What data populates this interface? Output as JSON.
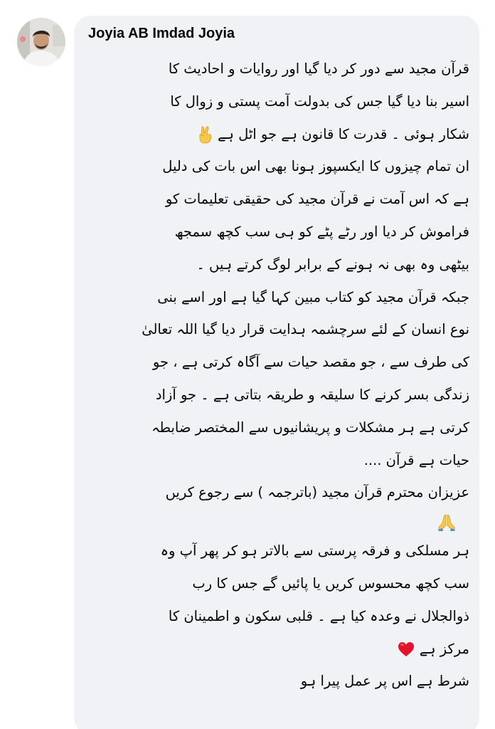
{
  "comment": {
    "author": "Joyia AB Imdad Joyia",
    "lines": [
      "قرآن مجید سے دور کر دیا گیا اور روایات و احادیث کا",
      "اسیر بنا دیا گیا جس کی بدولت آمت پستی و زوال کا",
      "شکار ہوئی ۔ قدرت کا قانون ہے جو اٹل ہے",
      "ان تمام چیزوں کا ایکسپوز ہونا بھی اس بات کی دلیل",
      "ہے کہ اس آمت نے قرآن مجید کی حقیقی تعلیمات کو",
      "فراموش کر دیا اور رٹے پٹے کو ہی سب کچھ سمجھ",
      "بیٹھی وہ بھی نہ ہونے کے برابر لوگ کرتے ہیں ۔",
      "جبکہ قرآن مجید کو کتاب مبین کہا گیا ہے اور اسے بنی",
      "نوع انسان کے لئے سرچشمہ ہدایت قرار دیا گیا اللہ تعالیٰ",
      "کی طرف سے ، جو مقصد حیات سے آگاہ کرتی ہے ، جو",
      "زندگی بسر کرنے کا سلیقہ و طریقہ بتاتی ہے ۔ جو آزاد",
      "کرتی ہے ہر مشکلات و پریشانیوں سے المختصر ضابطہ",
      "حیات ہے قرآن ....",
      "عزیزان محترم قرآن مجید (باترجمہ ) سے رجوع کریں",
      "ہر مسلکی و فرقہ پرستی سے بالاتر ہو کر پھر آپ وہ",
      "سب کچھ محسوس کریں یا پائیں گے جس کا رب",
      "ذوالجلال نے وعدہ کیا ہے ۔ قلبی سکون و اطمینان کا",
      "مرکز ہے",
      "شرط ہے اس پر عمل پیرا ہو"
    ],
    "emojis": {
      "line3": "victory-hand-icon",
      "after_line14": "folded-hands-icon",
      "line18": "red-heart-icon"
    }
  },
  "colors": {
    "bubble_background": "#f0f2f5",
    "text": "#050505",
    "page_background": "#ffffff"
  }
}
